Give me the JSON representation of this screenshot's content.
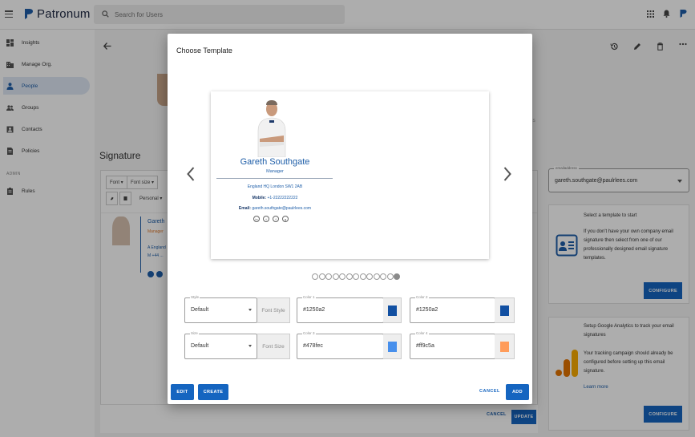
{
  "app": {
    "brand": "Patronum"
  },
  "search": {
    "placeholder": "Search for Users"
  },
  "sidebar": {
    "items": [
      {
        "label": "Insights",
        "icon": "dashboard-icon"
      },
      {
        "label": "Manage Org.",
        "icon": "building-icon"
      },
      {
        "label": "People",
        "icon": "person-icon",
        "active": true
      },
      {
        "label": "Groups",
        "icon": "group-icon"
      },
      {
        "label": "Contacts",
        "icon": "contact-card-icon"
      },
      {
        "label": "Policies",
        "icon": "document-icon"
      }
    ],
    "section_label": "ADMIN",
    "admin_items": [
      {
        "label": "Rules",
        "icon": "clipboard-icon"
      }
    ]
  },
  "page": {
    "section_title": "Signature",
    "toolbar": {
      "font": "Font",
      "font_size": "Font size",
      "personal": "Personal"
    },
    "mini_preview": {
      "name": "Gareth",
      "role": "Manager",
      "address_prefix": "A  England",
      "mobile_prefix": "M  +44 ..."
    },
    "cancel_label": "CANCEL",
    "update_label": "UPDATE",
    "behind_modal_text": "SS"
  },
  "right_panel": {
    "email_label": "emailaddress",
    "email_value": "gareth.southgate@paulrlees.com",
    "card1": {
      "title": "Select a template to start",
      "body": "If you don't have your own company email signature then select from one of our professionally designed email signature templates.",
      "button": "CONFIGURE"
    },
    "card2": {
      "title": "Setup Google Analytics to track your email signatures",
      "body": "Your tracking campaign should already be configured before setting up this email signature.",
      "link": "Learn more",
      "button": "CONFIGURE"
    }
  },
  "modal": {
    "title": "Choose Template",
    "template": {
      "name": "Gareth Southgate",
      "role": "Manager",
      "address": "England HQ London SW1 2AB",
      "mobile_label": "Mobile:",
      "mobile_value": "+1-22222222222",
      "email_label": "Email:",
      "email_value": "gareth.southgate@paulrlees.com",
      "social": [
        "in",
        "t",
        "f",
        "g"
      ]
    },
    "carousel": {
      "total_pages": 13,
      "active_page": 13
    },
    "fields": {
      "style": {
        "label": "Style",
        "value": "Default",
        "addon": "Font Style"
      },
      "size": {
        "label": "Size",
        "value": "Default",
        "addon": "Font Size"
      },
      "color1": {
        "label": "Color 1",
        "value": "#1250a2",
        "swatch": "#1250a2"
      },
      "color2": {
        "label": "Color 2",
        "value": "#1250a2",
        "swatch": "#1250a2"
      },
      "color3": {
        "label": "Color 3",
        "value": "#478fec",
        "swatch": "#478fec"
      },
      "color4": {
        "label": "Color 4",
        "value": "#ff9c5a",
        "swatch": "#ff9c5a"
      }
    },
    "buttons": {
      "edit": "EDIT",
      "create": "CREATE",
      "cancel": "CANCEL",
      "add": "ADD"
    }
  },
  "colors": {
    "primary": "#1565c0",
    "nav_active_bg": "#dfe8f5",
    "brand_dark": "#202a44"
  }
}
